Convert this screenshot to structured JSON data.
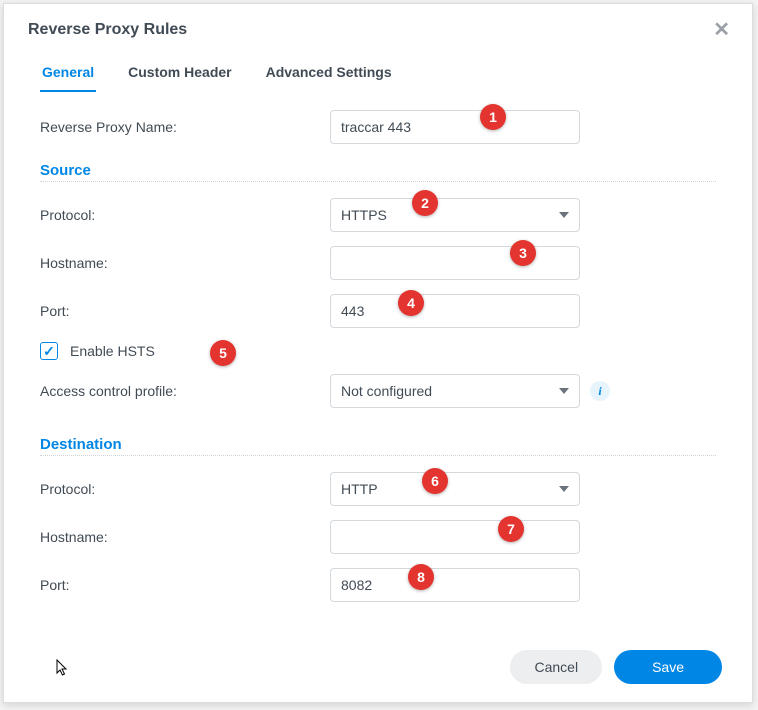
{
  "dialog": {
    "title": "Reverse Proxy Rules"
  },
  "tabs": {
    "general": "General",
    "custom_header": "Custom Header",
    "advanced_settings": "Advanced Settings"
  },
  "fields": {
    "name_label": "Reverse Proxy Name:",
    "name_value": "traccar 443"
  },
  "source": {
    "title": "Source",
    "protocol_label": "Protocol:",
    "protocol_value": "HTTPS",
    "hostname_label": "Hostname:",
    "hostname_value": "",
    "port_label": "Port:",
    "port_value": "443",
    "hsts_label": "Enable HSTS",
    "acp_label": "Access control profile:",
    "acp_value": "Not configured"
  },
  "destination": {
    "title": "Destination",
    "protocol_label": "Protocol:",
    "protocol_value": "HTTP",
    "hostname_label": "Hostname:",
    "hostname_value": "",
    "port_label": "Port:",
    "port_value": "8082"
  },
  "buttons": {
    "cancel": "Cancel",
    "save": "Save"
  },
  "badges": {
    "b1": "1",
    "b2": "2",
    "b3": "3",
    "b4": "4",
    "b5": "5",
    "b6": "6",
    "b7": "7",
    "b8": "8"
  }
}
